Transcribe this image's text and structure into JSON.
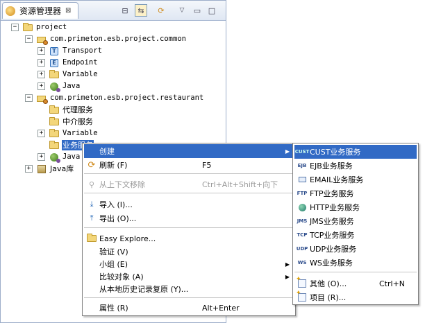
{
  "view": {
    "title": "资源管理器",
    "close": "⊠"
  },
  "tree": {
    "project": "project",
    "common_pkg": "com.primeton.esb.project.common",
    "common_children": [
      "Transport",
      "Endpoint",
      "Variable",
      "Java"
    ],
    "restaurant_pkg": "com.primeton.esb.project.restaurant",
    "restaurant_children": [
      "代理服务",
      "中介服务",
      "Variable",
      "业务服务",
      "Java"
    ],
    "javalib": "Java库"
  },
  "context_menu": {
    "items": [
      {
        "label": "创建",
        "shortcut": ""
      },
      {
        "label": "刷新 (F)",
        "shortcut": "F5"
      },
      {
        "label": "从上下文移除",
        "shortcut": "Ctrl+Alt+Shift+向下"
      },
      {
        "label": "导入 (I)...",
        "shortcut": ""
      },
      {
        "label": "导出 (O)...",
        "shortcut": ""
      },
      {
        "label": "Easy Explore...",
        "shortcut": ""
      },
      {
        "label": "验证 (V)",
        "shortcut": ""
      },
      {
        "label": "小组 (E)",
        "shortcut": ""
      },
      {
        "label": "比较对象 (A)",
        "shortcut": ""
      },
      {
        "label": "从本地历史记录复原 (Y)...",
        "shortcut": ""
      },
      {
        "label": "属性 (R)",
        "shortcut": "Alt+Enter"
      }
    ]
  },
  "submenu": {
    "items": [
      {
        "prefix": "CUST",
        "label": "CUST业务服务"
      },
      {
        "prefix": "EJB",
        "label": "EJB业务服务"
      },
      {
        "prefix": "",
        "label": "EMAIL业务服务"
      },
      {
        "prefix": "FTP",
        "label": "FTP业务服务"
      },
      {
        "prefix": "",
        "label": "HTTP业务服务"
      },
      {
        "prefix": "JMS",
        "label": "JMS业务服务"
      },
      {
        "prefix": "TCP",
        "label": "TCP业务服务"
      },
      {
        "prefix": "UDP",
        "label": "UDP业务服务"
      },
      {
        "prefix": "WS",
        "label": "WS业务服务"
      }
    ],
    "other": {
      "label": "其他 (O)...",
      "shortcut": "Ctrl+N"
    },
    "project": {
      "label": "项目 (R)..."
    }
  }
}
